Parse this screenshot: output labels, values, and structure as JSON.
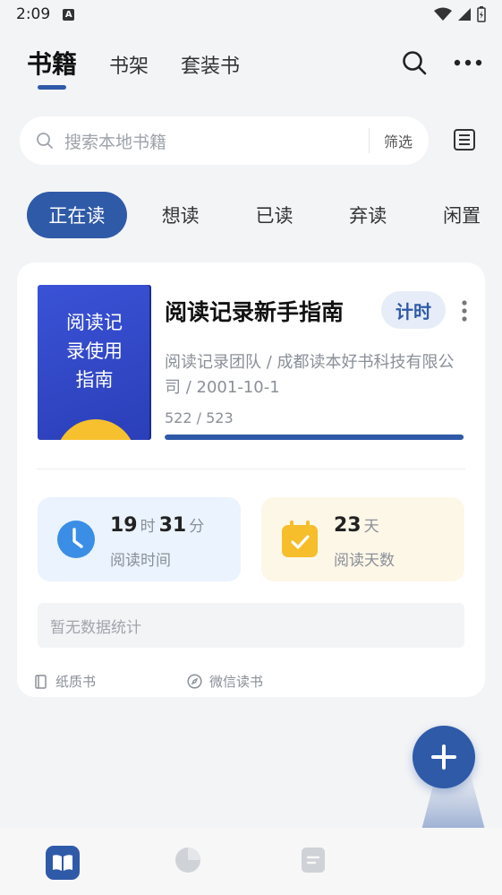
{
  "status_bar": {
    "time": "2:09",
    "notif_badge": "A"
  },
  "header": {
    "tabs": [
      {
        "label": "书籍",
        "active": true
      },
      {
        "label": "书架",
        "active": false
      },
      {
        "label": "套装书",
        "active": false
      }
    ],
    "icons": [
      "search-icon",
      "more-horizontal-icon"
    ]
  },
  "search": {
    "placeholder": "搜索本地书籍",
    "filter_label": "筛选",
    "list_icon": "list-view-icon"
  },
  "status_chips": [
    {
      "label": "正在读",
      "active": true
    },
    {
      "label": "想读",
      "active": false
    },
    {
      "label": "已读",
      "active": false
    },
    {
      "label": "弃读",
      "active": false
    },
    {
      "label": "闲置",
      "active": false
    }
  ],
  "book": {
    "cover_title": "阅读记录使用指南",
    "title": "阅读记录新手指南",
    "timer_label": "计时",
    "meta": "阅读记录团队 / 成都读本好书科技有限公司 / 2001-10-1",
    "progress_text": "522 / 523",
    "progress_current": 522,
    "progress_total": 523,
    "reading_time": {
      "hours": "19",
      "hours_unit": "时",
      "minutes": "31",
      "minutes_unit": "分",
      "label": "阅读时间"
    },
    "reading_days": {
      "days": "23",
      "days_unit": "天",
      "label": "阅读天数"
    },
    "no_data": "暂无数据统计",
    "tags": [
      {
        "label": "纸质书",
        "icon": "book-icon"
      },
      {
        "label": "微信读书",
        "icon": "compass-icon"
      }
    ]
  },
  "colors": {
    "accent": "#2f5aa8",
    "timer_bg": "#e7edf8",
    "time_box": "#eaf3fe",
    "days_box": "#fdf7e8",
    "clock": "#3a8ee6",
    "calendar": "#f5be2a"
  },
  "bottom_nav": [
    {
      "icon": "open-book-icon",
      "active": true
    },
    {
      "icon": "pie-chart-icon",
      "active": false
    },
    {
      "icon": "note-icon",
      "active": false
    }
  ]
}
